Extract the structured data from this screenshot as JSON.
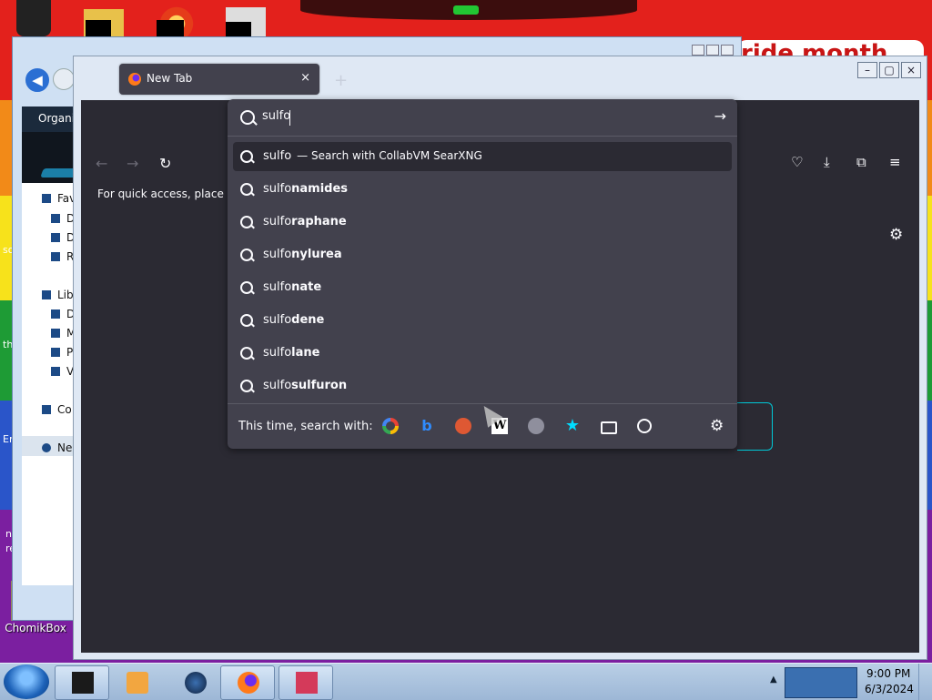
{
  "desktop": {
    "wallpaper_text": "ride month",
    "side_texts": [
      "so",
      "th",
      "Er",
      "n",
      "re"
    ],
    "icon_label": "ChomikBox"
  },
  "explorer": {
    "organize_label": "Organiz",
    "nav_items": [
      "Fav",
      "D",
      "D",
      "R",
      "Lib",
      "D",
      "M",
      "P",
      "V",
      "Co",
      "Ne"
    ]
  },
  "firefox": {
    "tab_title": "New Tab",
    "tab_close": "×",
    "new_tab": "+",
    "back": "←",
    "forward": "→",
    "reload": "↻",
    "toolbar_right": {
      "pocket": "♡",
      "downloads": "⤓",
      "extensions": "⧉",
      "menu": "≡"
    },
    "bookmark_hint": "For quick access, place your l",
    "page_settings_icon": "⚙",
    "window_buttons": [
      "–",
      "▢",
      "×"
    ]
  },
  "urlbar": {
    "value": "sulfo",
    "go_icon": "→",
    "first_suggestion": {
      "text": "sulfo",
      "engine": "— Search with CollabVM SearXNG"
    },
    "suggestions": [
      {
        "prefix": "sulfo",
        "completion": "namides"
      },
      {
        "prefix": "sulfo",
        "completion": "raphane"
      },
      {
        "prefix": "sulfo",
        "completion": "nylurea"
      },
      {
        "prefix": "sulfo",
        "completion": "nate"
      },
      {
        "prefix": "sulfo",
        "completion": "dene"
      },
      {
        "prefix": "sulfo",
        "completion": "lane"
      },
      {
        "prefix": "sulfo",
        "completion": "sulfuron"
      }
    ],
    "oneoff_label": "This time, search with:",
    "oneoff_engines": [
      "google-icon",
      "bing-icon",
      "duckduckgo-icon",
      "wikipedia-icon",
      "searxng-icon",
      "bookmarks-icon",
      "tabs-icon",
      "history-icon"
    ],
    "wiki_glyph": "W",
    "bing_glyph": "b",
    "bookmark_glyph": "★",
    "settings_icon": "⚙"
  },
  "taskbar": {
    "time": "9:00 PM",
    "date": "6/3/2024",
    "tray_arrow": "▲"
  },
  "colors": {
    "ff_dark": "#2b2a33",
    "ff_panel": "#42414d",
    "ff_text": "#fbfbfe",
    "focus_ring": "#00c8d7"
  }
}
